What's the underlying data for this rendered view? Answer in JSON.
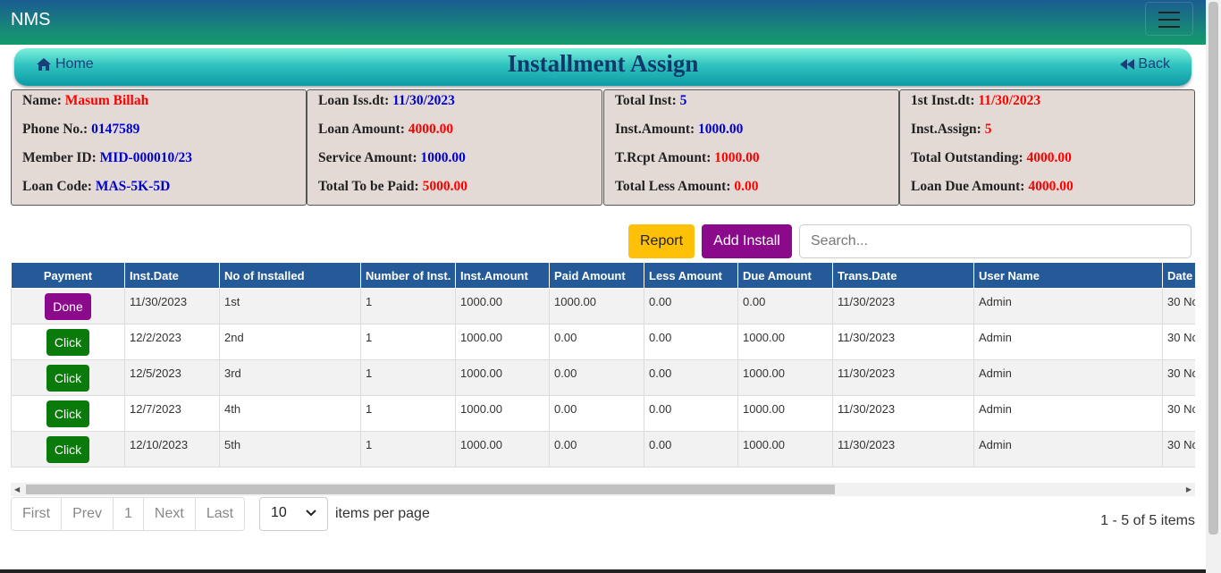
{
  "app": {
    "brand": "NMS"
  },
  "header": {
    "home_label": "Home",
    "title": "Installment Assign",
    "back_label": "Back"
  },
  "info": {
    "member": [
      {
        "label": "Name:",
        "value": "Masum Billah",
        "color": "red"
      },
      {
        "label": "Phone No.:",
        "value": "0147589",
        "color": "blue"
      },
      {
        "label": "Member ID:",
        "value": "MID-000010/23",
        "color": "blue"
      },
      {
        "label": "Loan Code:",
        "value": "MAS-5K-5D",
        "color": "blue"
      }
    ],
    "loan": [
      {
        "label": "Loan Iss.dt:",
        "value": "11/30/2023",
        "color": "blue"
      },
      {
        "label": "Loan Amount:",
        "value": "4000.00",
        "color": "red"
      },
      {
        "label": "Service Amount:",
        "value": "1000.00",
        "color": "blue"
      },
      {
        "label": "Total To be Paid:",
        "value": "5000.00",
        "color": "red"
      }
    ],
    "totals": [
      {
        "label": "Total Inst:",
        "value": "5",
        "color": "blue"
      },
      {
        "label": "Inst.Amount:",
        "value": "1000.00",
        "color": "blue"
      },
      {
        "label": "T.Rcpt Amount:",
        "value": "1000.00",
        "color": "red"
      },
      {
        "label": "Total Less Amount:",
        "value": "0.00",
        "color": "red"
      }
    ],
    "assign": [
      {
        "label": "1st Inst.dt:",
        "value": "11/30/2023",
        "color": "red"
      },
      {
        "label": "Inst.Assign:",
        "value": "5",
        "color": "red"
      },
      {
        "label": "Total Outstanding:",
        "value": "4000.00",
        "color": "red"
      },
      {
        "label": "Loan Due Amount:",
        "value": "4000.00",
        "color": "red"
      }
    ]
  },
  "toolbar": {
    "report_label": "Report",
    "add_install_label": "Add Install",
    "search_placeholder": "Search..."
  },
  "table": {
    "columns": [
      "Payment",
      "Inst.Date",
      "No of Installed",
      "Number of Inst.",
      "Inst.Amount",
      "Paid Amount",
      "Less Amount",
      "Due Amount",
      "Trans.Date",
      "User Name",
      "Date"
    ],
    "rows": [
      {
        "action": "Done",
        "inst_date": "11/30/2023",
        "no_installed": "1st",
        "number_inst": "1",
        "inst_amount": "1000.00",
        "paid": "1000.00",
        "less": "0.00",
        "due": "0.00",
        "trans_date": "11/30/2023",
        "user": "Admin",
        "date": "30 No"
      },
      {
        "action": "Click",
        "inst_date": "12/2/2023",
        "no_installed": "2nd",
        "number_inst": "1",
        "inst_amount": "1000.00",
        "paid": "0.00",
        "less": "0.00",
        "due": "1000.00",
        "trans_date": "11/30/2023",
        "user": "Admin",
        "date": "30 No"
      },
      {
        "action": "Click",
        "inst_date": "12/5/2023",
        "no_installed": "3rd",
        "number_inst": "1",
        "inst_amount": "1000.00",
        "paid": "0.00",
        "less": "0.00",
        "due": "1000.00",
        "trans_date": "11/30/2023",
        "user": "Admin",
        "date": "30 No"
      },
      {
        "action": "Click",
        "inst_date": "12/7/2023",
        "no_installed": "4th",
        "number_inst": "1",
        "inst_amount": "1000.00",
        "paid": "0.00",
        "less": "0.00",
        "due": "1000.00",
        "trans_date": "11/30/2023",
        "user": "Admin",
        "date": "30 No"
      },
      {
        "action": "Click",
        "inst_date": "12/10/2023",
        "no_installed": "5th",
        "number_inst": "1",
        "inst_amount": "1000.00",
        "paid": "0.00",
        "less": "0.00",
        "due": "1000.00",
        "trans_date": "11/30/2023",
        "user": "Admin",
        "date": "30 No"
      }
    ]
  },
  "pagination": {
    "first": "First",
    "prev": "Prev",
    "page": "1",
    "next": "Next",
    "last": "Last",
    "per_page": "10",
    "per_page_label": "items per page",
    "summary": "1 - 5 of 5 items"
  },
  "colors": {
    "header_blue": "#255a99",
    "done": "#8b0a8b",
    "click": "#0a7a0a",
    "report": "#ffc107",
    "add_install": "#8b0a8b",
    "red_value": "#ff0000",
    "blue_value": "#0000cc"
  }
}
